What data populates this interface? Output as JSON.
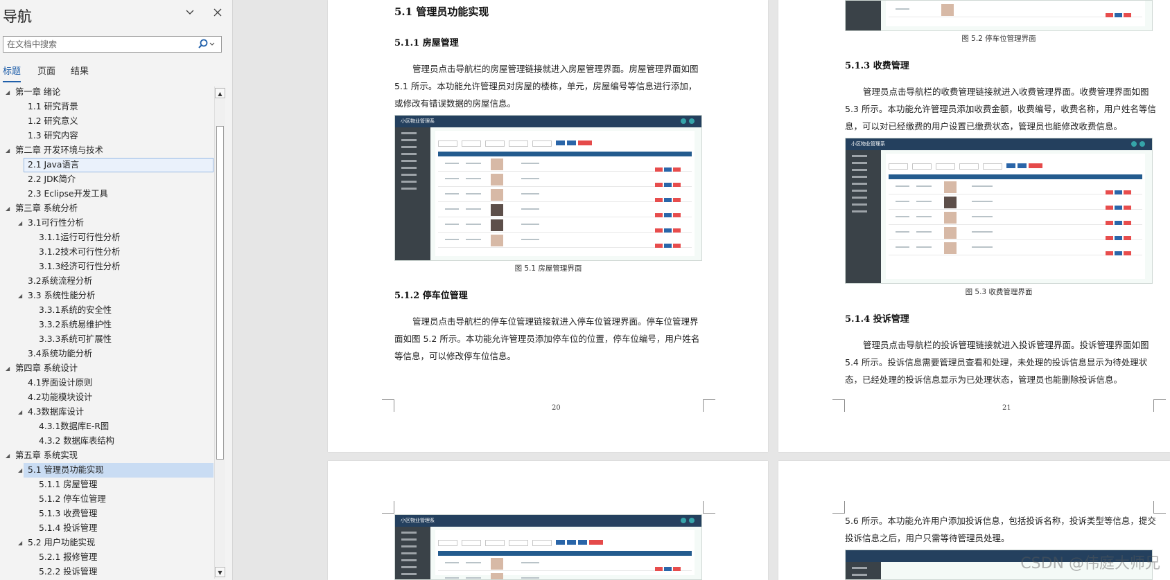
{
  "nav": {
    "title": "导航",
    "search_placeholder": "在文档中搜索",
    "tabs": [
      "标题",
      "页面",
      "结果"
    ],
    "tree": [
      {
        "label": "第一章 绪论",
        "level": 0,
        "expanded": true
      },
      {
        "label": "1.1 研究背景",
        "level": 1
      },
      {
        "label": "1.2 研究意义",
        "level": 1
      },
      {
        "label": "1.3 研究内容",
        "level": 1
      },
      {
        "label": "第二章 开发环境与技术",
        "level": 0,
        "expanded": true
      },
      {
        "label": "2.1 Java语言",
        "level": 1,
        "box": true
      },
      {
        "label": "2.2 JDK简介",
        "level": 1
      },
      {
        "label": "2.3 Eclipse开发工具",
        "level": 1
      },
      {
        "label": "第三章 系统分析",
        "level": 0,
        "expanded": true
      },
      {
        "label": "3.1可行性分析",
        "level": 1,
        "expanded": true
      },
      {
        "label": "3.1.1运行可行性分析",
        "level": 2
      },
      {
        "label": "3.1.2技术可行性分析",
        "level": 2
      },
      {
        "label": "3.1.3经济可行性分析",
        "level": 2
      },
      {
        "label": "3.2系统流程分析",
        "level": 1
      },
      {
        "label": "3.3 系统性能分析",
        "level": 1,
        "expanded": true
      },
      {
        "label": "3.3.1系统的安全性",
        "level": 2
      },
      {
        "label": "3.3.2系统易维护性",
        "level": 2
      },
      {
        "label": "3.3.3系统可扩展性",
        "level": 2
      },
      {
        "label": "3.4系统功能分析",
        "level": 1
      },
      {
        "label": "第四章 系统设计",
        "level": 0,
        "expanded": true
      },
      {
        "label": "4.1界面设计原则",
        "level": 1
      },
      {
        "label": "4.2功能模块设计",
        "level": 1
      },
      {
        "label": "4.3数据库设计",
        "level": 1,
        "expanded": true
      },
      {
        "label": "4.3.1数据库E-R图",
        "level": 2
      },
      {
        "label": "4.3.2 数据库表结构",
        "level": 2
      },
      {
        "label": "第五章 系统实现",
        "level": 0,
        "expanded": true
      },
      {
        "label": "5.1 管理员功能实现",
        "level": 1,
        "expanded": true,
        "selected": true
      },
      {
        "label": "5.1.1 房屋管理",
        "level": 2
      },
      {
        "label": "5.1.2 停车位管理",
        "level": 2
      },
      {
        "label": "5.1.3 收费管理",
        "level": 2
      },
      {
        "label": "5.1.4 投诉管理",
        "level": 2
      },
      {
        "label": "5.2 用户功能实现",
        "level": 1,
        "expanded": true
      },
      {
        "label": "5.2.1 报修管理",
        "level": 2
      },
      {
        "label": "5.2.2 投诉管理",
        "level": 2
      }
    ]
  },
  "page20": {
    "h_51": "5.1  管理员功能实现",
    "h_511": "5.1.1  房屋管理",
    "p1": "管理员点击导航栏的房屋管理链接就进入房屋管理界面。房屋管理界面如图 5.1 所示。本功能允许管理员对房屋的楼栋，单元，房屋编号等信息进行添加，或修改有错误数据的房屋信息。",
    "fig1_title": "小区物业管理系",
    "cap1": "图 5.1  房屋管理界面",
    "h_512": "5.1.2  停车位管理",
    "p2": "管理员点击导航栏的停车位管理链接就进入停车位管理界面。停车位管理界面如图 5.2 所示。本功能允许管理员添加停车位的位置，停车位编号，用户姓名等信息，可以修改停车位信息。",
    "page_number": "20"
  },
  "page21": {
    "cap2": "图 5.2  停车位管理界面",
    "h_513": "5.1.3  收费管理",
    "p3": "管理员点击导航栏的收费管理链接就进入收费管理界面。收费管理界面如图 5.3 所示。本功能允许管理员添加收费金额，收费编号，收费名称，用户姓名等信息，可以对已经缴费的用户设置已缴费状态，管理员也能修改收费信息。",
    "fig3_title": "小区物业管理系",
    "cap3": "图 5.3  收费管理界面",
    "h_514": "5.1.4  投诉管理",
    "p4": "管理员点击导航栏的投诉管理链接就进入投诉管理界面。投诉管理界面如图 5.4 所示。投诉信息需要管理员查看和处理，未处理的投诉信息显示为待处理状态，已经处理的投诉信息显示为已处理状态，管理员也能删除投诉信息。",
    "page_number": "21"
  },
  "page22": {
    "fig4_title": "小区物业管理系"
  },
  "page23": {
    "p5": "5.6 所示。本功能允许用户添加投诉信息，包括投诉名称，投诉类型等信息，提交投诉信息之后，用户只需等待管理员处理。"
  },
  "watermark": "CSDN @伟庭大师兄"
}
